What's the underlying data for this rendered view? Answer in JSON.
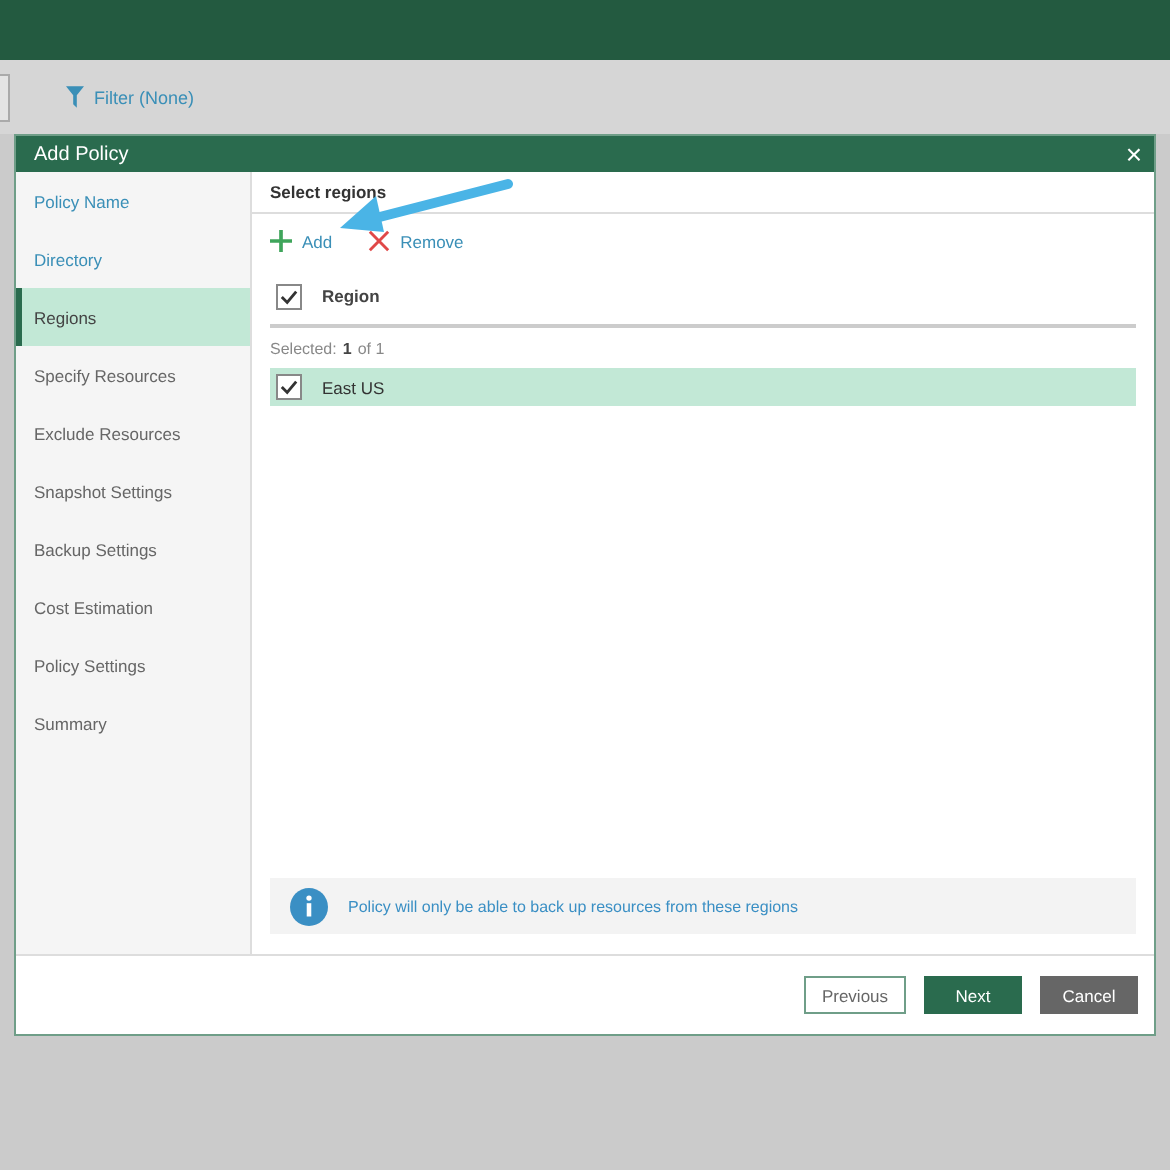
{
  "toolbar": {
    "filter": "Filter (None)"
  },
  "dialog": {
    "title": "Add Policy",
    "close": "×",
    "steps": [
      {
        "label": "Policy Name",
        "selected": false,
        "completed": true
      },
      {
        "label": "Directory",
        "selected": false,
        "completed": true
      },
      {
        "label": "Regions",
        "selected": true,
        "completed": false
      },
      {
        "label": "Specify Resources",
        "selected": false,
        "completed": false
      },
      {
        "label": "Exclude Resources",
        "selected": false,
        "completed": false
      },
      {
        "label": "Snapshot Settings",
        "selected": false,
        "completed": false
      },
      {
        "label": "Backup Settings",
        "selected": false,
        "completed": false
      },
      {
        "label": "Cost Estimation",
        "selected": false,
        "completed": false
      },
      {
        "label": "Policy Settings",
        "selected": false,
        "completed": false
      },
      {
        "label": "Summary",
        "selected": false,
        "completed": false
      }
    ],
    "section_title": "Select regions",
    "actions": [
      {
        "label": "Add",
        "kind": "add"
      },
      {
        "label": "Remove",
        "kind": "remove"
      }
    ],
    "table": {
      "header_checked": true,
      "column": "Region",
      "selected_label": "Selected:",
      "selected_count": "1",
      "selected_of": "of 1",
      "rows": [
        {
          "name": "East US",
          "checked": true,
          "selected": true
        }
      ]
    },
    "info": "Policy will only be able to back up resources from these regions",
    "buttons": [
      {
        "label": "Previous",
        "kind": "outline"
      },
      {
        "label": "Next",
        "kind": "primary"
      },
      {
        "label": "Cancel",
        "kind": "dark"
      }
    ]
  }
}
